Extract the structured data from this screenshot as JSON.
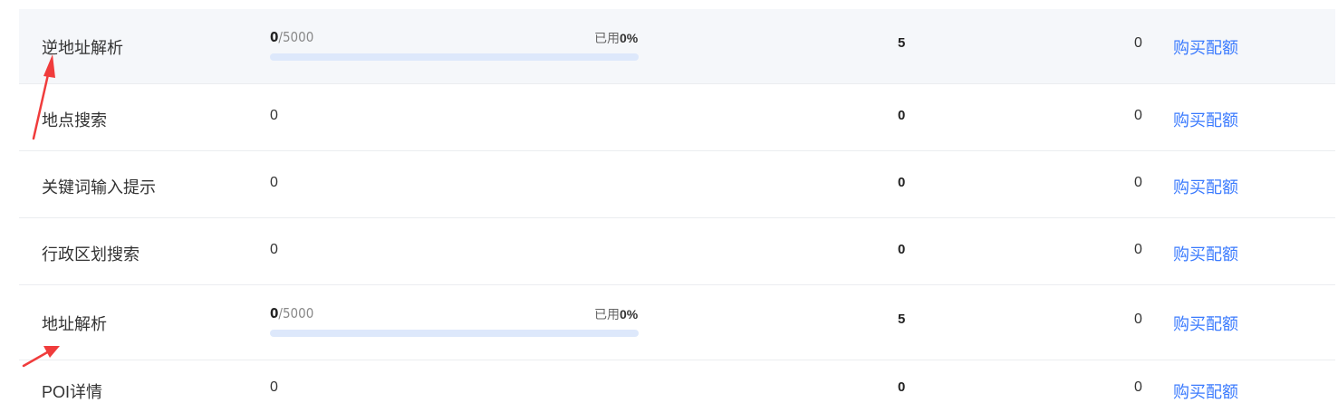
{
  "action_label": "购买配额",
  "used_prefix": "已用",
  "rows": [
    {
      "name": "逆地址解析",
      "usage": {
        "used": "0",
        "separator": "/",
        "total": "5000",
        "percent": "0%",
        "fraction": 0
      },
      "limit": "5",
      "bought": "0"
    },
    {
      "name": "地点搜索",
      "usage_plain": "0",
      "limit": "0",
      "bought": "0"
    },
    {
      "name": "关键词输入提示",
      "usage_plain": "0",
      "limit": "0",
      "bought": "0"
    },
    {
      "name": "行政区划搜索",
      "usage_plain": "0",
      "limit": "0",
      "bought": "0"
    },
    {
      "name": "地址解析",
      "usage": {
        "used": "0",
        "separator": "/",
        "total": "5000",
        "percent": "0%",
        "fraction": 0
      },
      "limit": "5",
      "bought": "0"
    },
    {
      "name": "POI详情",
      "usage_plain": "0",
      "limit": "0",
      "bought": "0"
    }
  ],
  "colors": {
    "accent": "#3a7afe",
    "annotation": "#f03c3c",
    "row_highlight": "#f5f7fa",
    "bar_track": "#dde8fb"
  }
}
